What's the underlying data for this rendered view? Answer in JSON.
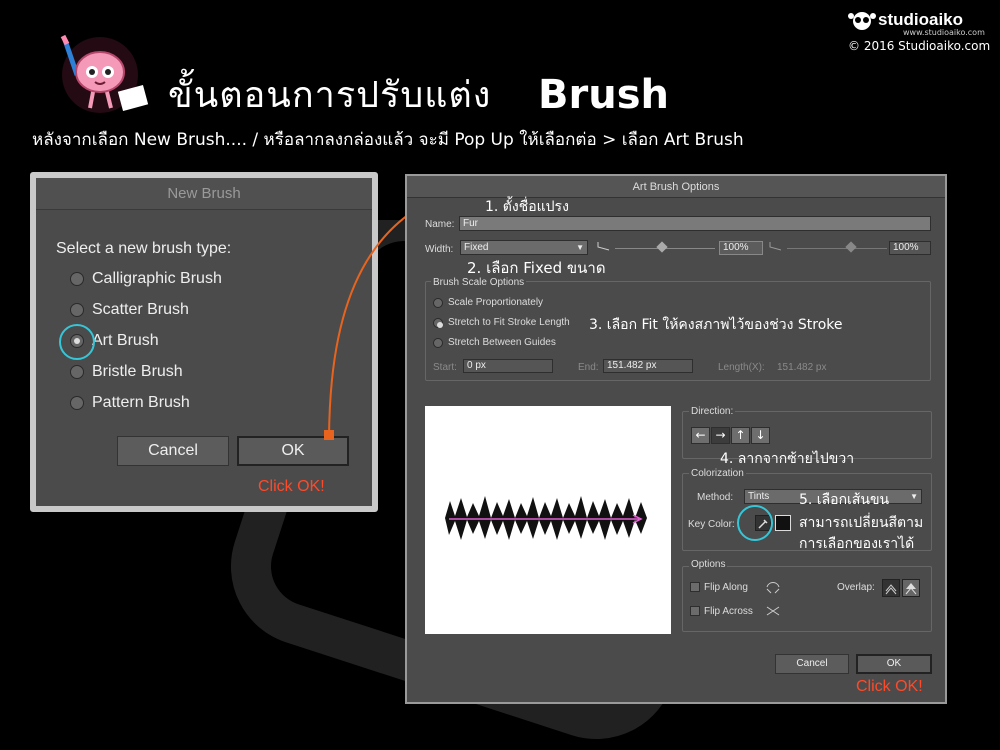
{
  "header": {
    "title_thai": "ขั้นตอนการปรับแต่ง",
    "title_en": "Brush",
    "subtitle": "หลังจากเลือก New Brush.... / หรือลากลงกล่องแล้ว จะมี Pop Up ให้เลือกต่อ > เลือก Art Brush"
  },
  "logo": {
    "name": "studioaiko",
    "url": "www.studioaiko.com",
    "copyright": "© 2016 Studioaiko.com"
  },
  "new_brush": {
    "title": "New Brush",
    "prompt": "Select a new brush type:",
    "options": [
      "Calligraphic Brush",
      "Scatter Brush",
      "Art Brush",
      "Bristle Brush",
      "Pattern Brush"
    ],
    "selected": "Art Brush",
    "cancel": "Cancel",
    "ok": "OK",
    "click_ok": "Click OK!"
  },
  "art_brush": {
    "title": "Art Brush Options",
    "name_label": "Name:",
    "name_value": "Fur",
    "width_label": "Width:",
    "width_value": "Fixed",
    "width_percent": "100%",
    "width_percent2": "100%",
    "scale_group": "Brush Scale Options",
    "scale_options": [
      "Scale Proportionately",
      "Stretch to Fit Stroke Length",
      "Stretch Between Guides"
    ],
    "scale_selected": "Stretch to Fit Stroke Length",
    "start_label": "Start:",
    "start_value": "0 px",
    "end_label": "End:",
    "end_value": "151.482 px",
    "length_label": "Length(X):",
    "length_value": "151.482 px",
    "direction_label": "Direction:",
    "direction_buttons": [
      "←",
      "→",
      "↑",
      "↓"
    ],
    "colorization_label": "Colorization",
    "method_label": "Method:",
    "method_value": "Tints",
    "key_color_label": "Key Color:",
    "options_label": "Options",
    "flip_along": "Flip Along",
    "flip_across": "Flip Across",
    "overlap_label": "Overlap:",
    "cancel": "Cancel",
    "ok": "OK",
    "click_ok": "Click OK!"
  },
  "annotations": {
    "step1": "1. ตั้งชื่อแปรง",
    "step2": "2. เลือก Fixed ขนาด",
    "step3": "3. เลือก Fit ให้คงสภาพไว้ของช่วง Stroke",
    "step4": "4. ลากจากซ้ายไปขวา",
    "step5": "5. เลือกเส้นขน",
    "step5b": "สามารถเปลี่ยนสีตาม",
    "step5c": "การเลือกของเราได้"
  },
  "colors": {
    "accent_cyan": "#35c6d8",
    "accent_orange": "#e8641e",
    "click_red": "#ff4a2a",
    "dialog_bg": "#4b4b4b"
  }
}
